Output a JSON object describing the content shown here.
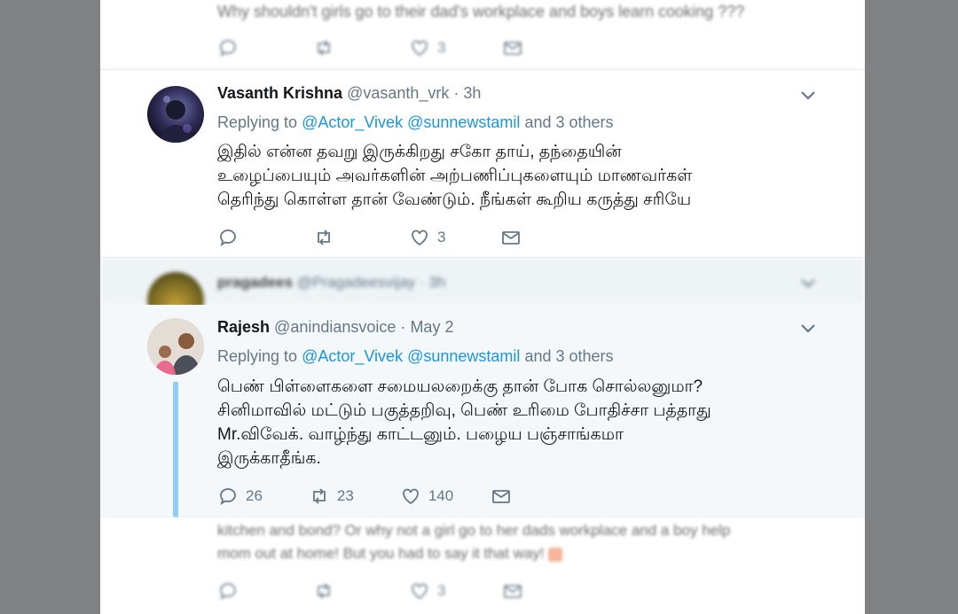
{
  "top_tweet": {
    "text": "Why shouldn't girls go to their dad's workplace and boys learn cooking ???",
    "likes": "3"
  },
  "tweet1": {
    "name": "Vasanth Krishna",
    "handle": "@vasanth_vrk",
    "dot": "·",
    "time": "3h",
    "replying_prefix": "Replying to",
    "mention1": "@Actor_Vivek",
    "mention2": "@sunnewstamil",
    "others": "and 3 others",
    "line1": "இதில் என்ன தவறு இருக்கிறது சகோ தாய், தந்தையின்",
    "line2": "உழைப்பையும் அவர்களின் அற்பணிப்புகளையும் மாணவர்கள்",
    "line3": "தெரிந்து கொள்ள தான் வேண்டும். நீங்கள் கூறிய கருத்து சரியே",
    "likes": "3"
  },
  "tweet_blurred": {
    "name": "pragadees",
    "handle": "@Pragadeesvijay",
    "dot": "·",
    "time": "3h"
  },
  "tweet2": {
    "name": "Rajesh",
    "handle": "@anindiansvoice",
    "dot": "·",
    "time": "May 2",
    "replying_prefix": "Replying to",
    "mention1": "@Actor_Vivek",
    "mention2": "@sunnewstamil",
    "others": "and 3 others",
    "line1": "பெண் பிள்ளைகளை சமையலறைக்கு தான் போக சொல்லனுமா?",
    "line2": "சினிமாவில் மட்டும் பகுத்தறிவு, பெண் உரிமை போதிச்சா பத்தாது",
    "line3": "Mr.விவேக். வாழ்ந்து காட்டனும். பழைய பஞ்சாங்கமா",
    "line4": "இருக்காதீங்க.",
    "replies": "26",
    "retweets": "23",
    "likes": "140",
    "accent": "#8ecdf8"
  },
  "bottom_tweet": {
    "line1": "kitchen and bond? Or why not a girl go to her dads workplace and a boy help",
    "line2": "mom out at home! But you had to say it that way!",
    "likes": "3"
  }
}
